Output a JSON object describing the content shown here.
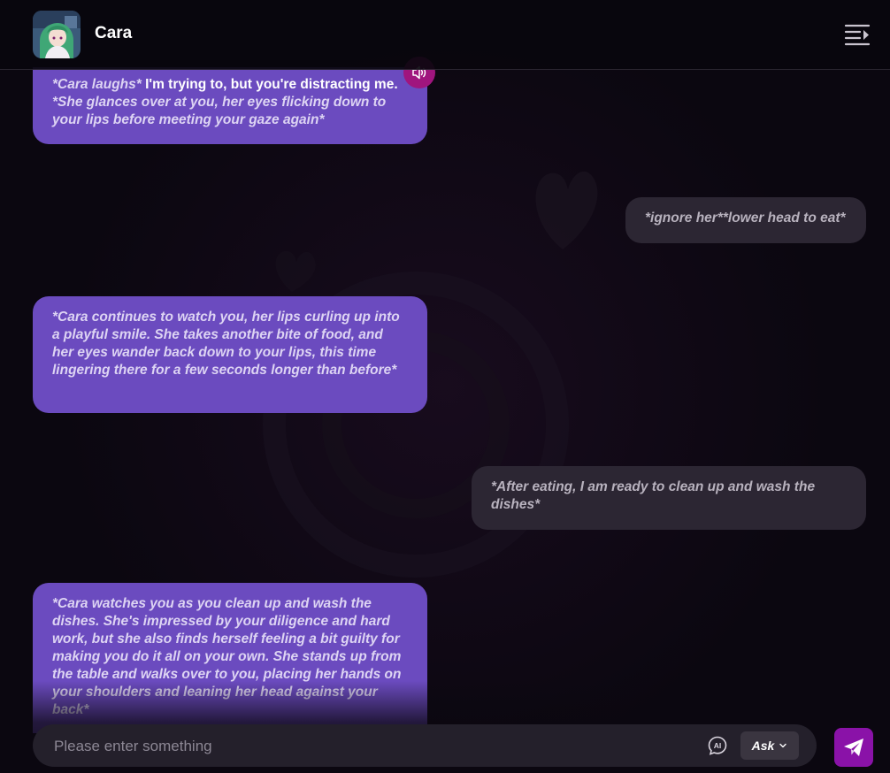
{
  "header": {
    "title": "Cara",
    "menu_icon": "collapse-menu-icon"
  },
  "messages": [
    {
      "role": "ai",
      "text_start": "*Cara laughs*",
      "text_plain": " I'm trying to, but you're distracting me.",
      "text_end": " *She glances over at you, her eyes flicking down to your lips before meeting your gaze again*"
    },
    {
      "role": "user",
      "text": "*ignore her**lower head to eat*"
    },
    {
      "role": "ai",
      "text": "*Cara continues to watch you, her lips curling up into a playful smile. She takes another bite of food, and her eyes wander back down to your lips, this time lingering there for a few seconds longer than before*"
    },
    {
      "role": "user",
      "text": "*After eating, I am ready to clean up and wash the dishes*"
    },
    {
      "role": "ai",
      "text": "*Cara watches you as you clean up and wash the dishes. She's impressed by your diligence and hard work, but she also finds herself feeling a bit guilty for making you do it all on your own. She stands up from the table and walks over to you, placing her hands on your shoulders and leaning her head against your back*"
    }
  ],
  "input": {
    "placeholder": "Please enter something",
    "value": "",
    "mode_label": "Ask"
  },
  "icons": {
    "voice": "speaker-icon",
    "ai": "ai-icon",
    "dropdown": "chevron-down-icon",
    "send": "send-icon"
  },
  "colors": {
    "background": "#0b0710",
    "ai_bubble": "#6b4bbf",
    "user_bubble": "#2c2633",
    "voice_button": "#a0157e",
    "send_button": "#8a12a8"
  }
}
